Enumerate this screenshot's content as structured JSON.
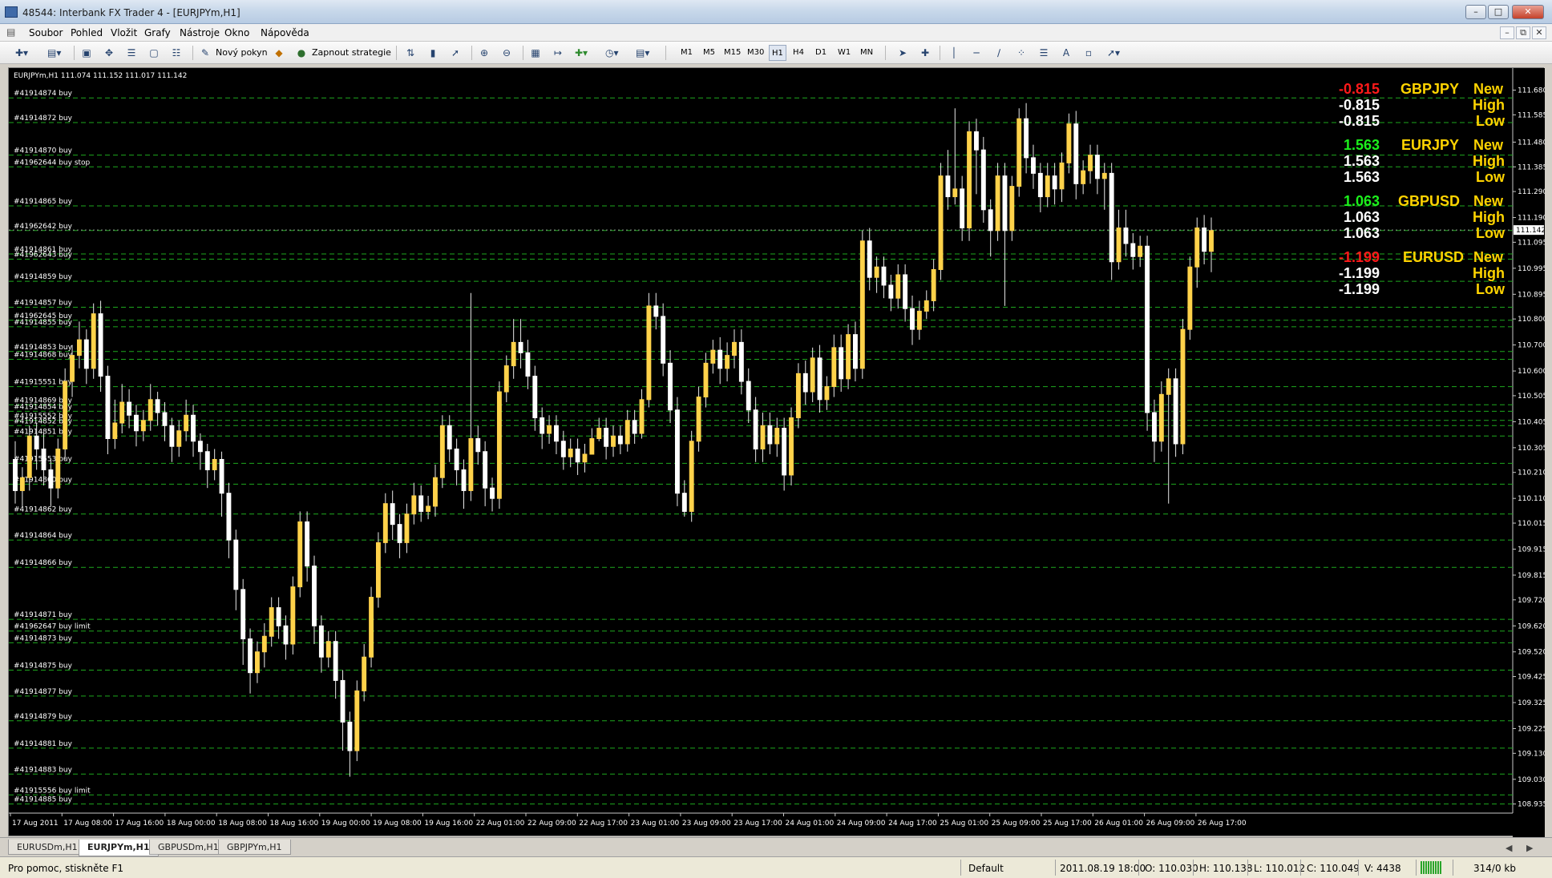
{
  "window": {
    "title": "48544: Interbank FX Trader 4 - [EURJPYm,H1]"
  },
  "menu": [
    "Soubor",
    "Pohled",
    "Vložit",
    "Grafy",
    "Nástroje",
    "Okno",
    "Nápověda"
  ],
  "toolbar": {
    "new_order": "Nový pokyn",
    "strategies": "Zapnout strategie",
    "timeframes": [
      "M1",
      "M5",
      "M15",
      "M30",
      "H1",
      "H4",
      "D1",
      "W1",
      "MN"
    ]
  },
  "chart": {
    "info": "EURJPYm,H1  111.074 111.152 111.017 111.142",
    "current_price": "111.142",
    "price_labels": [
      "111.680",
      "111.585",
      "111.480",
      "111.385",
      "111.290",
      "111.190",
      "111.095",
      "110.995",
      "110.895",
      "110.800",
      "110.700",
      "110.600",
      "110.505",
      "110.405",
      "110.305",
      "110.210",
      "110.110",
      "110.015",
      "109.915",
      "109.815",
      "109.720",
      "109.620",
      "109.520",
      "109.425",
      "109.325",
      "109.225",
      "109.130",
      "109.030",
      "108.935"
    ],
    "time_labels": [
      "17 Aug 2011",
      "17 Aug 08:00",
      "17 Aug 16:00",
      "18 Aug 00:00",
      "18 Aug 08:00",
      "18 Aug 16:00",
      "19 Aug 00:00",
      "19 Aug 08:00",
      "19 Aug 16:00",
      "22 Aug 01:00",
      "22 Aug 09:00",
      "22 Aug 17:00",
      "23 Aug 01:00",
      "23 Aug 09:00",
      "23 Aug 17:00",
      "24 Aug 01:00",
      "24 Aug 09:00",
      "24 Aug 17:00",
      "25 Aug 01:00",
      "25 Aug 09:00",
      "25 Aug 17:00",
      "26 Aug 01:00",
      "26 Aug 09:00",
      "26 Aug 17:00"
    ],
    "orders": [
      {
        "label": "#41914874 buy",
        "price": 111.65
      },
      {
        "label": "#41914872 buy",
        "price": 111.555
      },
      {
        "label": "#41914870 buy",
        "price": 111.43
      },
      {
        "label": "#41962644 buy stop",
        "price": 111.385
      },
      {
        "label": "#41914865 buy",
        "price": 111.235
      },
      {
        "label": "#41962642 buy",
        "price": 111.14
      },
      {
        "label": "#41914861 buy",
        "price": 111.05
      },
      {
        "label": "#41962643 buy",
        "price": 111.03
      },
      {
        "label": "#41914859 buy",
        "price": 110.945
      },
      {
        "label": "#41914857 buy",
        "price": 110.845
      },
      {
        "label": "#41962645 buy",
        "price": 110.795
      },
      {
        "label": "#41914855 buy",
        "price": 110.77
      },
      {
        "label": "#41914853 buy",
        "price": 110.675
      },
      {
        "label": "#41914868 buy",
        "price": 110.645
      },
      {
        "label": "#41915551 buy",
        "price": 110.54
      },
      {
        "label": "#41914869 buy",
        "price": 110.47
      },
      {
        "label": "#41914854 buy",
        "price": 110.445
      },
      {
        "label": "#41915552 buy",
        "price": 110.41
      },
      {
        "label": "#41914852 buy",
        "price": 110.39
      },
      {
        "label": "#41914851 buy",
        "price": 110.35
      },
      {
        "label": "#41915553 buy",
        "price": 110.245
      },
      {
        "label": "#41914860 buy",
        "price": 110.165
      },
      {
        "label": "#41914862 buy",
        "price": 110.05
      },
      {
        "label": "#41914864 buy",
        "price": 109.95
      },
      {
        "label": "#41914866 buy",
        "price": 109.845
      },
      {
        "label": "#41914871 buy",
        "price": 109.645
      },
      {
        "label": "#41962647 buy limit",
        "price": 109.6
      },
      {
        "label": "#41914873 buy",
        "price": 109.555
      },
      {
        "label": "#41914875 buy",
        "price": 109.45
      },
      {
        "label": "#41914877 buy",
        "price": 109.35
      },
      {
        "label": "#41914879 buy",
        "price": 109.255
      },
      {
        "label": "#41914881 buy",
        "price": 109.15
      },
      {
        "label": "#41914883 buy",
        "price": 109.05
      },
      {
        "label": "#41915556 buy limit",
        "price": 108.97
      },
      {
        "label": "#41914885 buy",
        "price": 108.935
      }
    ],
    "candles": [
      [
        110.26,
        110.14,
        110.33,
        110.09
      ],
      [
        110.14,
        110.19,
        110.23,
        110.08
      ],
      [
        110.19,
        110.35,
        110.39,
        110.14
      ],
      [
        110.35,
        110.3,
        110.4,
        110.22
      ],
      [
        110.3,
        110.22,
        110.36,
        110.16
      ],
      [
        110.22,
        110.15,
        110.26,
        110.08
      ],
      [
        110.15,
        110.3,
        110.34,
        110.11
      ],
      [
        110.3,
        110.56,
        110.61,
        110.26
      ],
      [
        110.56,
        110.66,
        110.7,
        110.5
      ],
      [
        110.66,
        110.72,
        110.79,
        110.61
      ],
      [
        110.72,
        110.61,
        110.76,
        110.55
      ],
      [
        110.61,
        110.82,
        110.86,
        110.57
      ],
      [
        110.82,
        110.58,
        110.87,
        110.52
      ],
      [
        110.58,
        110.34,
        110.62,
        110.28
      ],
      [
        110.34,
        110.4,
        110.49,
        110.3
      ],
      [
        110.4,
        110.48,
        110.55,
        110.36
      ],
      [
        110.48,
        110.43,
        110.53,
        110.38
      ],
      [
        110.43,
        110.37,
        110.47,
        110.31
      ],
      [
        110.37,
        110.41,
        110.45,
        110.33
      ],
      [
        110.41,
        110.49,
        110.55,
        110.37
      ],
      [
        110.49,
        110.44,
        110.52,
        110.39
      ],
      [
        110.44,
        110.39,
        110.48,
        110.33
      ],
      [
        110.39,
        110.31,
        110.42,
        110.25
      ],
      [
        110.31,
        110.37,
        110.41,
        110.27
      ],
      [
        110.37,
        110.43,
        110.49,
        110.33
      ],
      [
        110.43,
        110.33,
        110.47,
        110.27
      ],
      [
        110.33,
        110.29,
        110.36,
        110.22
      ],
      [
        110.29,
        110.22,
        110.32,
        110.15
      ],
      [
        110.22,
        110.26,
        110.3,
        110.18
      ],
      [
        110.26,
        110.13,
        110.29,
        110.04
      ],
      [
        110.13,
        109.95,
        110.17,
        109.88
      ],
      [
        109.95,
        109.76,
        109.99,
        109.68
      ],
      [
        109.76,
        109.57,
        109.8,
        109.47
      ],
      [
        109.57,
        109.44,
        109.61,
        109.36
      ],
      [
        109.44,
        109.52,
        109.56,
        109.4
      ],
      [
        109.52,
        109.58,
        109.63,
        109.46
      ],
      [
        109.58,
        109.69,
        109.73,
        109.54
      ],
      [
        109.69,
        109.62,
        109.73,
        109.57
      ],
      [
        109.62,
        109.55,
        109.66,
        109.49
      ],
      [
        109.55,
        109.77,
        109.81,
        109.51
      ],
      [
        109.77,
        110.02,
        110.06,
        109.73
      ],
      [
        110.02,
        109.85,
        110.06,
        109.79
      ],
      [
        109.85,
        109.62,
        109.89,
        109.55
      ],
      [
        109.62,
        109.5,
        109.66,
        109.44
      ],
      [
        109.5,
        109.56,
        109.6,
        109.46
      ],
      [
        109.56,
        109.41,
        109.6,
        109.34
      ],
      [
        109.41,
        109.25,
        109.45,
        109.14
      ],
      [
        109.25,
        109.14,
        109.29,
        109.04
      ],
      [
        109.14,
        109.37,
        109.41,
        109.1
      ],
      [
        109.37,
        109.5,
        109.55,
        109.33
      ],
      [
        109.5,
        109.73,
        109.77,
        109.46
      ],
      [
        109.73,
        109.94,
        109.98,
        109.69
      ],
      [
        109.94,
        110.09,
        110.13,
        109.9
      ],
      [
        110.09,
        110.01,
        110.14,
        109.95
      ],
      [
        110.01,
        109.94,
        110.05,
        109.88
      ],
      [
        109.94,
        110.05,
        110.09,
        109.9
      ],
      [
        110.05,
        110.12,
        110.17,
        110.01
      ],
      [
        110.12,
        110.06,
        110.16,
        110.02
      ],
      [
        110.06,
        110.08,
        110.12,
        110.03
      ],
      [
        110.08,
        110.19,
        110.24,
        110.04
      ],
      [
        110.19,
        110.39,
        110.43,
        110.15
      ],
      [
        110.39,
        110.3,
        110.43,
        110.25
      ],
      [
        110.3,
        110.22,
        110.34,
        110.16
      ],
      [
        110.22,
        110.14,
        110.26,
        110.07
      ],
      [
        110.14,
        110.34,
        110.9,
        110.1
      ],
      [
        110.34,
        110.29,
        110.39,
        110.24
      ],
      [
        110.29,
        110.15,
        110.33,
        110.08
      ],
      [
        110.15,
        110.11,
        110.19,
        110.06
      ],
      [
        110.11,
        110.52,
        110.56,
        110.07
      ],
      [
        110.52,
        110.62,
        110.66,
        110.48
      ],
      [
        110.62,
        110.71,
        110.8,
        110.57
      ],
      [
        110.71,
        110.67,
        110.8,
        110.61
      ],
      [
        110.67,
        110.58,
        110.72,
        110.53
      ],
      [
        110.58,
        110.42,
        110.62,
        110.37
      ],
      [
        110.42,
        110.36,
        110.46,
        110.3
      ],
      [
        110.36,
        110.39,
        110.43,
        110.32
      ],
      [
        110.39,
        110.33,
        110.43,
        110.28
      ],
      [
        110.33,
        110.27,
        110.37,
        110.22
      ],
      [
        110.27,
        110.3,
        110.34,
        110.23
      ],
      [
        110.3,
        110.25,
        110.34,
        110.2
      ],
      [
        110.25,
        110.28,
        110.32,
        110.21
      ],
      [
        110.28,
        110.34,
        110.38,
        110.3
      ],
      [
        110.34,
        110.38,
        110.42,
        110.33
      ],
      [
        110.38,
        110.31,
        110.42,
        110.26
      ],
      [
        110.31,
        110.35,
        110.39,
        110.27
      ],
      [
        110.35,
        110.32,
        110.39,
        110.28
      ],
      [
        110.32,
        110.41,
        110.45,
        110.29
      ],
      [
        110.41,
        110.36,
        110.45,
        110.32
      ],
      [
        110.36,
        110.49,
        110.53,
        110.34
      ],
      [
        110.49,
        110.85,
        110.9,
        110.46
      ],
      [
        110.85,
        110.81,
        110.9,
        110.76
      ],
      [
        110.81,
        110.63,
        110.86,
        110.58
      ],
      [
        110.63,
        110.45,
        110.68,
        110.4
      ],
      [
        110.45,
        110.13,
        110.5,
        110.08
      ],
      [
        110.13,
        110.06,
        110.18,
        110.04
      ],
      [
        110.06,
        110.33,
        110.37,
        110.02
      ],
      [
        110.33,
        110.5,
        110.54,
        110.29
      ],
      [
        110.5,
        110.63,
        110.67,
        110.46
      ],
      [
        110.63,
        110.68,
        110.72,
        110.59
      ],
      [
        110.68,
        110.61,
        110.73,
        110.55
      ],
      [
        110.61,
        110.66,
        110.71,
        110.56
      ],
      [
        110.66,
        110.71,
        110.76,
        110.61
      ],
      [
        110.71,
        110.56,
        110.76,
        110.51
      ],
      [
        110.56,
        110.45,
        110.61,
        110.4
      ],
      [
        110.45,
        110.3,
        110.5,
        110.25
      ],
      [
        110.3,
        110.39,
        110.44,
        110.25
      ],
      [
        110.39,
        110.32,
        110.44,
        110.28
      ],
      [
        110.32,
        110.38,
        110.42,
        110.27
      ],
      [
        110.38,
        110.2,
        110.42,
        110.14
      ],
      [
        110.2,
        110.42,
        110.46,
        110.16
      ],
      [
        110.42,
        110.59,
        110.63,
        110.38
      ],
      [
        110.59,
        110.52,
        110.64,
        110.47
      ],
      [
        110.52,
        110.65,
        110.69,
        110.48
      ],
      [
        110.65,
        110.49,
        110.7,
        110.44
      ],
      [
        110.49,
        110.54,
        110.58,
        110.45
      ],
      [
        110.54,
        110.69,
        110.74,
        110.5
      ],
      [
        110.69,
        110.57,
        110.74,
        110.52
      ],
      [
        110.57,
        110.74,
        110.78,
        110.53
      ],
      [
        110.74,
        110.61,
        110.79,
        110.56
      ],
      [
        110.61,
        111.1,
        111.14,
        110.57
      ],
      [
        111.1,
        110.96,
        111.15,
        110.91
      ],
      [
        110.96,
        111.0,
        111.04,
        110.9
      ],
      [
        111.0,
        110.93,
        111.04,
        110.88
      ],
      [
        110.93,
        110.88,
        110.97,
        110.83
      ],
      [
        110.88,
        110.97,
        111.01,
        110.84
      ],
      [
        110.97,
        110.84,
        111.01,
        110.79
      ],
      [
        110.84,
        110.76,
        110.89,
        110.7
      ],
      [
        110.76,
        110.83,
        110.87,
        110.72
      ],
      [
        110.83,
        110.87,
        110.91,
        110.8
      ],
      [
        110.87,
        110.99,
        111.03,
        110.83
      ],
      [
        110.99,
        111.35,
        111.4,
        110.95
      ],
      [
        111.35,
        111.27,
        111.45,
        111.22
      ],
      [
        111.27,
        111.3,
        111.61,
        111.24
      ],
      [
        111.3,
        111.15,
        111.35,
        111.1
      ],
      [
        111.15,
        111.52,
        111.56,
        111.1
      ],
      [
        111.52,
        111.45,
        111.57,
        111.28
      ],
      [
        111.45,
        111.22,
        111.5,
        111.17
      ],
      [
        111.22,
        111.14,
        111.26,
        111.04
      ],
      [
        111.14,
        111.35,
        111.4,
        111.1
      ],
      [
        111.35,
        111.14,
        111.4,
        110.85
      ],
      [
        111.14,
        111.31,
        111.35,
        111.1
      ],
      [
        111.31,
        111.57,
        111.61,
        111.27
      ],
      [
        111.57,
        111.42,
        111.63,
        111.36
      ],
      [
        111.42,
        111.36,
        111.47,
        111.3
      ],
      [
        111.36,
        111.27,
        111.4,
        111.21
      ],
      [
        111.27,
        111.35,
        111.4,
        111.23
      ],
      [
        111.35,
        111.3,
        111.4,
        111.24
      ],
      [
        111.3,
        111.4,
        111.44,
        111.25
      ],
      [
        111.4,
        111.55,
        111.59,
        111.36
      ],
      [
        111.55,
        111.32,
        111.6,
        111.26
      ],
      [
        111.32,
        111.37,
        111.41,
        111.28
      ],
      [
        111.37,
        111.43,
        111.47,
        111.32
      ],
      [
        111.43,
        111.34,
        111.47,
        111.28
      ],
      [
        111.34,
        111.36,
        111.4,
        111.22
      ],
      [
        111.36,
        111.02,
        111.4,
        110.95
      ],
      [
        111.02,
        111.15,
        111.22,
        110.99
      ],
      [
        111.15,
        111.09,
        111.22,
        111.04
      ],
      [
        111.09,
        111.04,
        111.13,
        110.99
      ],
      [
        111.04,
        111.08,
        111.12,
        111.0
      ],
      [
        111.08,
        110.44,
        111.12,
        110.37
      ],
      [
        110.44,
        110.33,
        110.49,
        110.25
      ],
      [
        110.33,
        110.51,
        110.56,
        110.29
      ],
      [
        110.51,
        110.57,
        110.61,
        110.09
      ],
      [
        110.57,
        110.32,
        110.61,
        110.27
      ],
      [
        110.32,
        110.76,
        110.8,
        110.28
      ],
      [
        110.76,
        111.0,
        111.04,
        110.72
      ],
      [
        111.0,
        111.15,
        111.19,
        110.92
      ],
      [
        111.15,
        111.06,
        111.2,
        111.01
      ],
      [
        111.06,
        111.14,
        111.19,
        110.98
      ]
    ]
  },
  "panel": [
    {
      "pair": "GBPJPY",
      "rows": [
        {
          "value": "-0.815",
          "color": "#ff1a1a",
          "label": "New"
        },
        {
          "value": "-0.815",
          "color": "#ffffff",
          "label": "High"
        },
        {
          "value": "-0.815",
          "color": "#ffffff",
          "label": "Low"
        }
      ]
    },
    {
      "pair": "EURJPY",
      "rows": [
        {
          "value": "1.563",
          "color": "#1cf01c",
          "label": "New"
        },
        {
          "value": "1.563",
          "color": "#ffffff",
          "label": "High"
        },
        {
          "value": "1.563",
          "color": "#ffffff",
          "label": "Low"
        }
      ]
    },
    {
      "pair": "GBPUSD",
      "rows": [
        {
          "value": "1.063",
          "color": "#1cf01c",
          "label": "New"
        },
        {
          "value": "1.063",
          "color": "#ffffff",
          "label": "High"
        },
        {
          "value": "1.063",
          "color": "#ffffff",
          "label": "Low"
        }
      ]
    },
    {
      "pair": "EURUSD",
      "rows": [
        {
          "value": "-1.199",
          "color": "#ff1a1a",
          "label": "New"
        },
        {
          "value": "-1.199",
          "color": "#ffffff",
          "label": "High"
        },
        {
          "value": "-1.199",
          "color": "#ffffff",
          "label": "Low"
        }
      ]
    }
  ],
  "tabs": [
    "EURUSDm,H1",
    "EURJPYm,H1",
    "GBPUSDm,H1",
    "GBPJPYm,H1"
  ],
  "active_tab": 1,
  "status": {
    "help": "Pro pomoc, stiskněte F1",
    "profile": "Default",
    "time": "2011.08.19 18:00",
    "open": "O: 110.030",
    "high": "H: 110.138",
    "low": "L: 110.012",
    "close": "C: 110.049",
    "volume": "V: 4438",
    "traffic": "314/0 kb"
  },
  "colors": {
    "bull": "#ffd24a",
    "bear": "#ffffff",
    "grid": "#1ea81e",
    "background": "#000000",
    "label": "#ffd400"
  }
}
